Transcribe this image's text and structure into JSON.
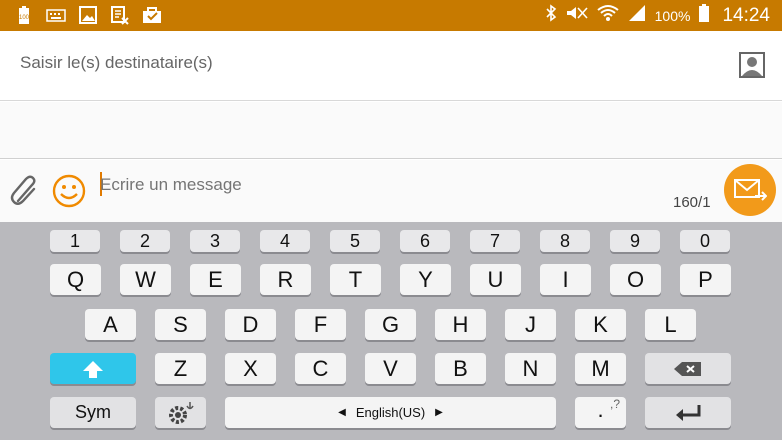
{
  "status_bar": {
    "battery_text": "100%",
    "time": "14:24",
    "left_icons": [
      "battery-100-icon",
      "keyboard-icon",
      "picture-icon",
      "calendar-icon",
      "briefcase-icon"
    ],
    "right_icons": [
      "bluetooth-icon",
      "mute-icon",
      "wifi-icon",
      "signal-icon",
      "battery-icon"
    ]
  },
  "recipient": {
    "placeholder": "Saisir le(s) destinataire(s)"
  },
  "compose": {
    "placeholder": "Ecrire un message",
    "counter": "160/1"
  },
  "keyboard": {
    "numbers": [
      "1",
      "2",
      "3",
      "4",
      "5",
      "6",
      "7",
      "8",
      "9",
      "0"
    ],
    "row1": [
      "Q",
      "W",
      "E",
      "R",
      "T",
      "Y",
      "U",
      "I",
      "O",
      "P"
    ],
    "row2": [
      "A",
      "S",
      "D",
      "F",
      "G",
      "H",
      "J",
      "K",
      "L"
    ],
    "row3": [
      "Z",
      "X",
      "C",
      "V",
      "B",
      "N",
      "M"
    ],
    "sym_label": "Sym",
    "space_label": "English(US)",
    "punct_main": ".",
    "punct_alt": ",?"
  },
  "colors": {
    "status_bar": "#c77a00",
    "send_button": "#f29a1a",
    "shift_key": "#2fc6ea",
    "keyboard_bg": "#b9b9bd"
  }
}
